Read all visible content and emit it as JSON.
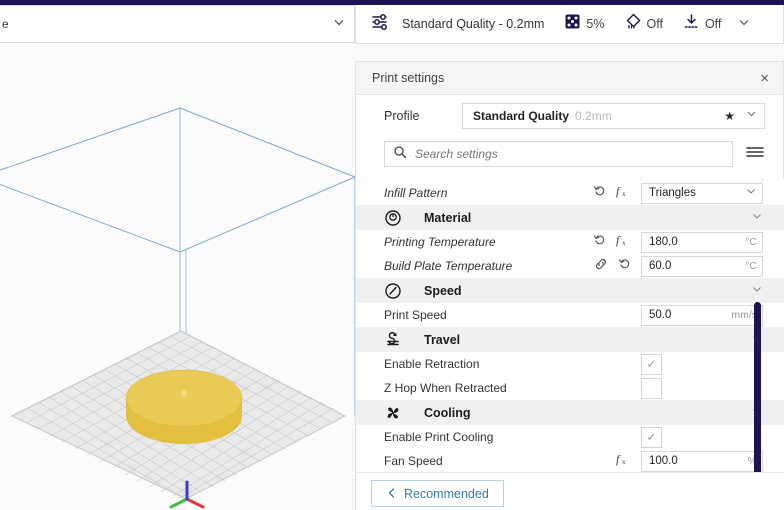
{
  "window": {
    "machine_selector": {
      "value": "e",
      "chevron": "chevron-down-icon"
    }
  },
  "print_setup_header": {
    "sliders_icon": "sliders-icon",
    "profile_label": "Standard Quality - 0.2mm",
    "summary": [
      {
        "icon": "infill-icon",
        "value": "5%"
      },
      {
        "icon": "support-icon",
        "value": "Off"
      },
      {
        "icon": "adhesion-icon",
        "value": "Off"
      }
    ],
    "chevron": "chevron-down-icon"
  },
  "print_settings_panel": {
    "title": "Print settings",
    "close_label": "×",
    "profile": {
      "label": "Profile",
      "name": "Standard Quality",
      "sub": "0.2mm",
      "star": "★",
      "chevron": "chevron-down-icon"
    },
    "search": {
      "placeholder": "Search settings",
      "value": "",
      "icon": "search-icon",
      "menu_icon": "hamburger-menu-icon"
    },
    "settings": [
      {
        "kind": "cutoff-row",
        "label": "",
        "field_value": ""
      },
      {
        "kind": "setting",
        "label": "Infill Pattern",
        "italic": true,
        "icons": [
          "revert-icon",
          "function-icon"
        ],
        "control": "dropdown",
        "value": "Triangles",
        "unit": ""
      },
      {
        "kind": "category",
        "label": "Material",
        "icon": "material-spool-icon",
        "chevron": "chevron-down-icon"
      },
      {
        "kind": "setting",
        "label": "Printing Temperature",
        "italic": true,
        "icons": [
          "revert-icon",
          "function-icon"
        ],
        "control": "text",
        "value": "180.0",
        "unit": "°C"
      },
      {
        "kind": "setting",
        "label": "Build Plate Temperature",
        "italic": true,
        "icons": [
          "link-icon",
          "revert-icon"
        ],
        "control": "text",
        "value": "60.0",
        "unit": "°C"
      },
      {
        "kind": "category",
        "label": "Speed",
        "icon": "speedometer-icon",
        "chevron": "chevron-down-icon"
      },
      {
        "kind": "setting",
        "label": "Print Speed",
        "italic": false,
        "icons": [],
        "control": "text",
        "value": "50.0",
        "unit": "mm/s"
      },
      {
        "kind": "category",
        "label": "Travel",
        "icon": "travel-icon",
        "chevron": "chevron-down-icon"
      },
      {
        "kind": "setting",
        "label": "Enable Retraction",
        "italic": false,
        "icons": [],
        "control": "checkbox",
        "checked": true,
        "value": "",
        "unit": ""
      },
      {
        "kind": "setting",
        "label": "Z Hop When Retracted",
        "italic": false,
        "icons": [],
        "control": "checkbox",
        "checked": false,
        "value": "",
        "unit": ""
      },
      {
        "kind": "category",
        "label": "Cooling",
        "icon": "fan-icon",
        "chevron": "chevron-down-icon"
      },
      {
        "kind": "setting",
        "label": "Enable Print Cooling",
        "italic": false,
        "icons": [],
        "control": "checkbox",
        "checked": true,
        "value": "",
        "unit": ""
      },
      {
        "kind": "setting",
        "label": "Fan Speed",
        "italic": false,
        "icons": [
          "function-icon"
        ],
        "control": "text",
        "value": "100.0",
        "unit": "%"
      }
    ],
    "bottom": {
      "recommended_label": "Recommended",
      "recommended_chevron": "chevron-left-icon"
    }
  },
  "viewport": {
    "model": "cylinder-disc",
    "model_color": "#e8c954",
    "buildplate_grid": true,
    "volume_wireframe_color": "#7fa8d4",
    "axis_x_color": "#e03a3a",
    "axis_y_color": "#3fc03f",
    "axis_z_color": "#3a3ad0"
  },
  "colors": {
    "brand_dark": "#1c1453",
    "link_blue": "#3a7ca8",
    "panel_bg": "#ffffff",
    "category_bg": "#f0f0f0"
  }
}
